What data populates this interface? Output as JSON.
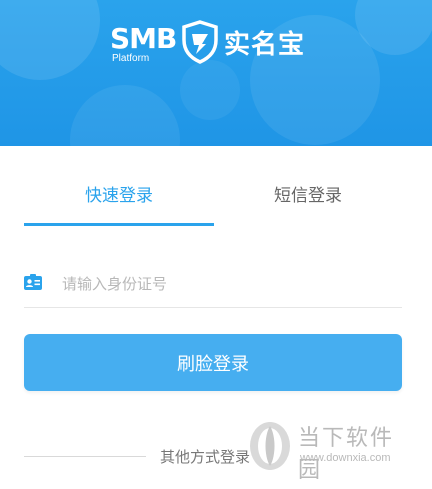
{
  "header": {
    "logo_text": "SMB",
    "logo_subtext": "Platform",
    "logo_title": "实名宝",
    "background_color": "#1f95e6"
  },
  "tabs": [
    {
      "label": "快速登录",
      "active": true
    },
    {
      "label": "短信登录",
      "active": false
    }
  ],
  "id_field": {
    "icon": "id-card-icon",
    "placeholder": "请输入身份证号",
    "value": ""
  },
  "face_login": {
    "label": "刷脸登录",
    "color": "#46aef0"
  },
  "other_methods": {
    "label": "其他方式登录"
  },
  "watermark": {
    "title": "当下软件园",
    "url": "www.downxia.com",
    "icon": "leaf-logo-icon"
  },
  "accent_color": "#2aa3ec"
}
